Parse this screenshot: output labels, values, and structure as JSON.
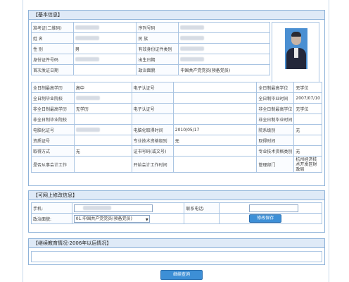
{
  "basic": {
    "header": "【基本信息】",
    "rows": [
      [
        {
          "l": "准考证(二维码)"
        },
        {
          "v": "",
          "blur": true
        },
        {
          "l": "序列号码"
        },
        {
          "v": "",
          "blur": true
        }
      ],
      [
        {
          "l": "姓 名"
        },
        {
          "v": "",
          "blur": true
        },
        {
          "l": "民 族"
        },
        {
          "v": "",
          "blur": true
        }
      ],
      [
        {
          "l": "性 别"
        },
        {
          "v": "男"
        },
        {
          "l": "有效身份证件类别"
        },
        {
          "v": "",
          "blur": true
        }
      ],
      [
        {
          "l": "身份证件号码"
        },
        {
          "v": "",
          "blur": true
        },
        {
          "l": "出生日期"
        },
        {
          "v": "",
          "blur": true
        }
      ],
      [
        {
          "l": "首次发证日期"
        },
        {
          "v": ""
        },
        {
          "l": "政治面貌"
        },
        {
          "v": "中国共产党党员(预备党员)"
        }
      ]
    ],
    "wide_rows": [
      [
        {
          "l": "全日制最高学历"
        },
        {
          "v": "高中"
        },
        {
          "l": "电子认证号"
        },
        {
          "v": ""
        },
        {
          "l": "全日制最高学位"
        },
        {
          "v": "无学位"
        }
      ],
      [
        {
          "l": "全日制毕业院校"
        },
        {
          "v": "",
          "blur": true
        },
        {
          "l": ""
        },
        {
          "v": ""
        },
        {
          "l": "全日制毕业时间"
        },
        {
          "v": "2007/07/10"
        }
      ],
      [
        {
          "l": "非全日制最高学历"
        },
        {
          "v": "无学历"
        },
        {
          "l": "电子认证号"
        },
        {
          "v": ""
        },
        {
          "l": "非全日制最高学位"
        },
        {
          "v": "无学位"
        }
      ],
      [
        {
          "l": "非全日制毕业院校"
        },
        {
          "v": ""
        },
        {
          "l": ""
        },
        {
          "v": ""
        },
        {
          "l": "非全日制毕业时间"
        },
        {
          "v": ""
        }
      ],
      [
        {
          "l": "电脑化证号"
        },
        {
          "v": "",
          "blur": true
        },
        {
          "l": "电脑化取得时间"
        },
        {
          "v": "2010/05/17"
        },
        {
          "l": "院系级别"
        },
        {
          "v": "无"
        }
      ],
      [
        {
          "l": "资质证号"
        },
        {
          "v": ""
        },
        {
          "l": "专业技术资格级别"
        },
        {
          "v": "无"
        },
        {
          "l": "取得时间"
        },
        {
          "v": ""
        }
      ],
      [
        {
          "l": "取得方式"
        },
        {
          "v": "无"
        },
        {
          "l": "证书号码(或文号)"
        },
        {
          "v": ""
        },
        {
          "l": "专业技术资格类别"
        },
        {
          "v": "无"
        }
      ],
      [
        {
          "l": "是否从事会计工作"
        },
        {
          "v": ""
        },
        {
          "l": "开始会计工作时间"
        },
        {
          "v": ""
        },
        {
          "l": "管理部门"
        },
        {
          "v": "杭州经济技术开发区财政局"
        }
      ]
    ]
  },
  "editable": {
    "header": "【可网上修改信息】",
    "phone_label": "手机:",
    "phone_value": "",
    "contact_label": "联系电话:",
    "political_label": "政治面貌:",
    "political_value": "01.中国共产党党员(预备党员)",
    "save_label": "修改保存"
  },
  "edu": {
    "header": "【继续教育情况-2006年以后情况】"
  },
  "footer": {
    "query_label": "继续查询"
  },
  "colors": {
    "accent": "#3d8fd6",
    "border": "#8fb3d9",
    "header_bg": "#dfeaf7"
  }
}
